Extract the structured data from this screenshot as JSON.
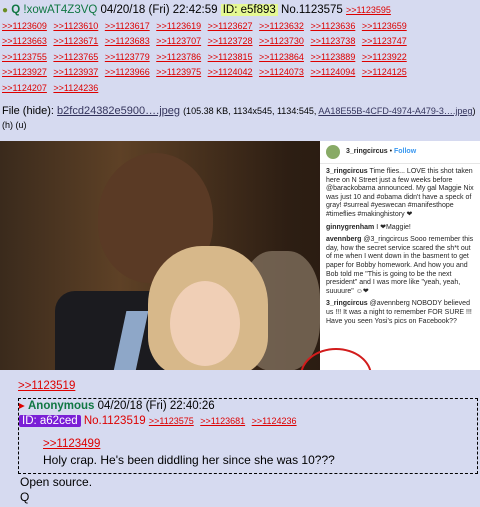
{
  "post": {
    "marker": "●",
    "name": "Q",
    "tripcode": "!xowAT4Z3VQ",
    "date": "04/20/18 (Fri) 22:42:59",
    "id_label": "ID: e5f893",
    "number": "No.1123575",
    "backlinks": [
      ">>1123595",
      ">>1123609",
      ">>1123610",
      ">>1123617",
      ">>1123619",
      ">>1123627",
      ">>1123632",
      ">>1123636",
      ">>1123659",
      ">>1123663",
      ">>1123671",
      ">>1123683",
      ">>1123707",
      ">>1123728",
      ">>1123730",
      ">>1123738",
      ">>1123747",
      ">>1123755",
      ">>1123765",
      ">>1123779",
      ">>1123786",
      ">>1123815",
      ">>1123864",
      ">>1123889",
      ">>1123922",
      ">>1123927",
      ">>1123937",
      ">>1123966",
      ">>1123975",
      ">>1124042",
      ">>1124073",
      ">>1124094",
      ">>1124125",
      ">>1124207",
      ">>1124236"
    ]
  },
  "file": {
    "label": "File",
    "hide": "(hide):",
    "filename": "b2fcd24382e5900….jpeg",
    "meta": "(105.38 KB, 1134x545, 1134:545,",
    "orig": "AA18E55B-4CFD-4974-A479-3….jpeg",
    "tail": ") (h) (u)"
  },
  "instagram": {
    "user": "3_ringcircus",
    "follow": "Follow",
    "comments": [
      {
        "user": "3_ringcircus",
        "text": "Time flies... LOVE this shot taken here on N Street just a few weeks before @barackobama announced. My gal Maggie Nix was just 10 and #obama didn't have a speck of gray! #surreal #yeswecan #manifesthope #timeflies #makinghistory ❤"
      },
      {
        "user": "ginnygrenham",
        "text": "I ❤Maggie!"
      },
      {
        "user": "avennberg",
        "text": "@3_ringcircus Sooo remember this day, how the secret service scared the sh*t out of me when I went down in the basment to get paper for Bobby homework. And how you and Bob told me \"This is going to be the next president\" and I was more like \"yeah, yeah, suuuure\" ☺❤"
      },
      {
        "user": "3_ringcircus",
        "text": "@avennberg NOBODY believed us !!! It was a night to remember FOR SURE !!! Have you seen Yosi's pics on Facebook??"
      }
    ]
  },
  "reply": {
    "quote_above": ">>1123519",
    "marker": "▸",
    "name": "Anonymous",
    "date": "04/20/18 (Fri) 22:40:26",
    "id_label": "ID: a62ced",
    "number": "No.1123519",
    "backlinks": [
      ">>1123575",
      ">>1123681",
      ">>1124236"
    ],
    "quote": ">>1123499",
    "text": "Holy crap. He's been diddling her since she was 10???"
  },
  "footer": {
    "line1": "Open source.",
    "line2": "Q"
  },
  "colors": {
    "background": "#d6daf0",
    "trip": "#117743",
    "id_badge": "#e5f893",
    "reply_id": "#7a1fd6",
    "link": "#dd0000",
    "circle": "#d21c1c"
  }
}
